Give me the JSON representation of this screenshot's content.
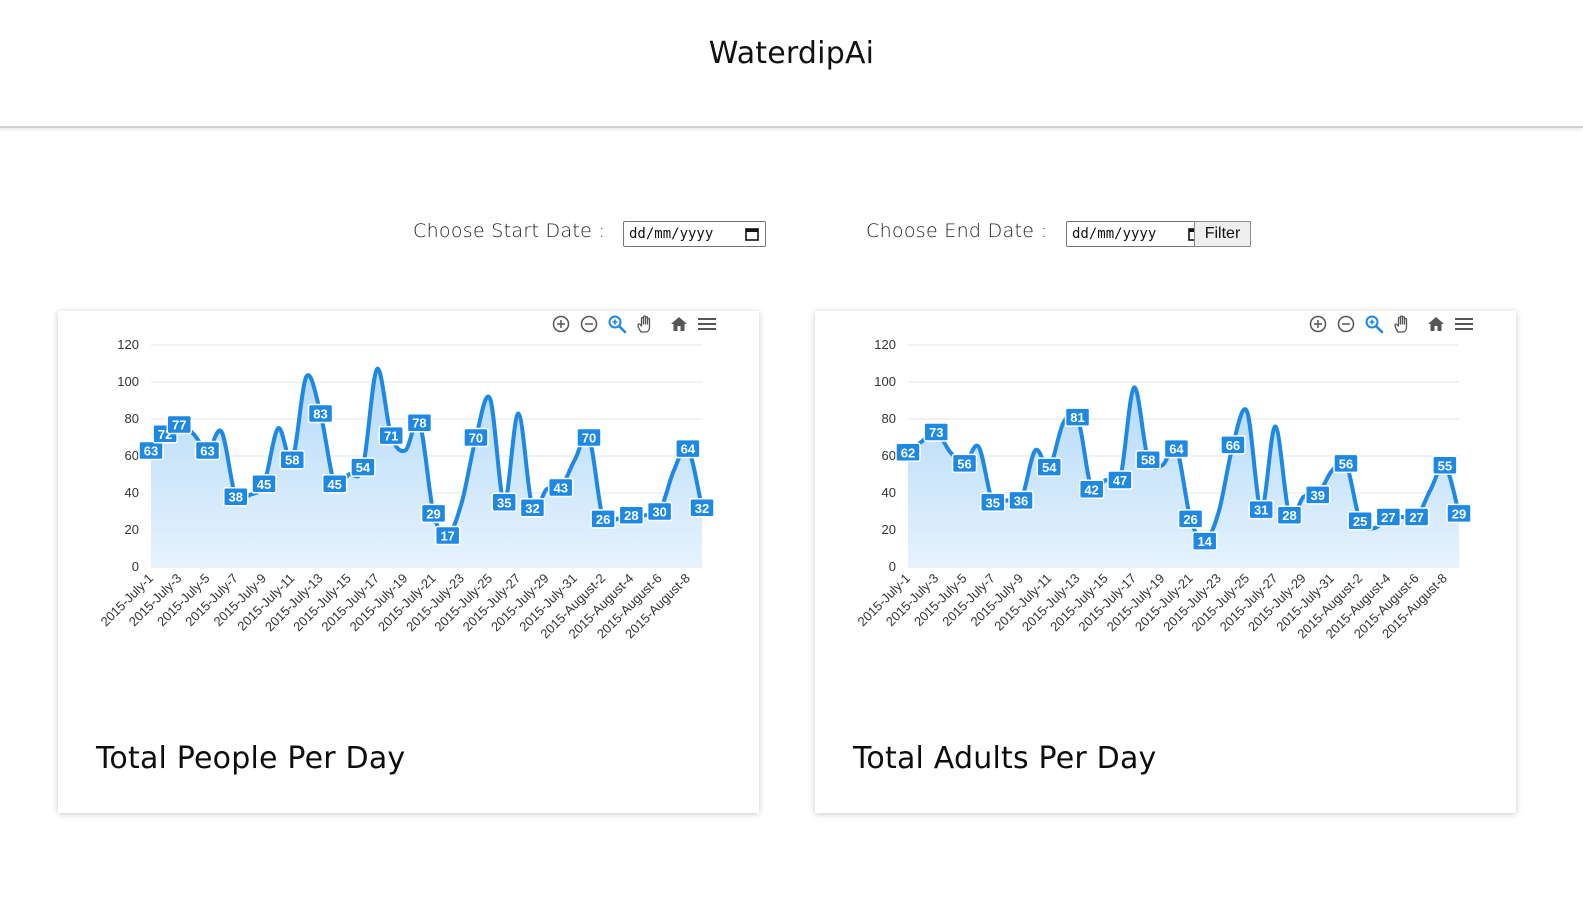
{
  "app": {
    "title": "WaterdipAi"
  },
  "filter": {
    "start_label": "Choose Start Date :",
    "end_label": "Choose End Date :",
    "date_placeholder": "dd/mm/yyyy",
    "filter_button": "Filter"
  },
  "toolbar_icons": [
    "zoom-in-icon",
    "zoom-out-icon",
    "selection-zoom-icon",
    "pan-hand-icon",
    "reset-home-icon",
    "menu-icon"
  ],
  "colors": {
    "accent": "#1e88e5",
    "fill_top": "#a9d4f7",
    "fill_bottom": "#e3f1fd",
    "grid": "#e6e6e6"
  },
  "charts": [
    {
      "title": "Total People Per Day",
      "chart_data": {
        "type": "area",
        "smooth": true,
        "ylim": [
          0,
          120
        ],
        "yticks": [
          0,
          20,
          40,
          60,
          80,
          100,
          120
        ],
        "x_tick_labels": [
          "2015-July-1",
          "2015-July-3",
          "2015-July-5",
          "2015-July-7",
          "2015-July-9",
          "2015-July-11",
          "2015-July-13",
          "2015-July-15",
          "2015-July-17",
          "2015-July-19",
          "2015-July-21",
          "2015-July-23",
          "2015-July-25",
          "2015-July-27",
          "2015-July-29",
          "2015-July-31",
          "2015-August-2",
          "2015-August-4",
          "2015-August-6",
          "2015-August-8"
        ],
        "values": [
          63,
          72,
          77,
          72,
          63,
          73,
          38,
          39,
          45,
          75,
          58,
          103,
          83,
          45,
          50,
          54,
          107,
          71,
          63,
          78,
          29,
          17,
          35,
          70,
          91,
          35,
          83,
          32,
          42,
          43,
          58,
          70,
          26,
          26,
          28,
          28,
          30,
          52,
          64,
          32
        ],
        "labels": [
          1,
          1,
          1,
          0,
          1,
          0,
          1,
          0,
          1,
          0,
          1,
          0,
          1,
          1,
          0,
          1,
          0,
          1,
          0,
          1,
          1,
          1,
          0,
          1,
          0,
          1,
          0,
          1,
          0,
          1,
          0,
          1,
          1,
          0,
          1,
          0,
          1,
          0,
          1,
          1
        ]
      }
    },
    {
      "title": "Total Adults Per Day",
      "chart_data": {
        "type": "area",
        "smooth": true,
        "ylim": [
          0,
          120
        ],
        "yticks": [
          0,
          20,
          40,
          60,
          80,
          100,
          120
        ],
        "x_tick_labels": [
          "2015-July-1",
          "2015-July-3",
          "2015-July-5",
          "2015-July-7",
          "2015-July-9",
          "2015-July-11",
          "2015-July-13",
          "2015-July-15",
          "2015-July-17",
          "2015-July-19",
          "2015-July-21",
          "2015-July-23",
          "2015-July-25",
          "2015-July-27",
          "2015-July-29",
          "2015-July-31",
          "2015-August-2",
          "2015-August-4",
          "2015-August-6",
          "2015-August-8"
        ],
        "values": [
          62,
          68,
          73,
          62,
          56,
          65,
          35,
          36,
          36,
          63,
          54,
          78,
          81,
          42,
          47,
          47,
          97,
          58,
          55,
          64,
          26,
          14,
          30,
          66,
          84,
          31,
          76,
          28,
          38,
          39,
          52,
          56,
          25,
          21,
          27,
          27,
          27,
          42,
          55,
          29
        ],
        "labels": [
          1,
          0,
          1,
          0,
          1,
          0,
          1,
          0,
          1,
          0,
          1,
          0,
          1,
          1,
          0,
          1,
          0,
          1,
          0,
          1,
          1,
          1,
          0,
          1,
          0,
          1,
          0,
          1,
          0,
          1,
          0,
          1,
          1,
          0,
          1,
          0,
          1,
          0,
          1,
          1
        ]
      }
    }
  ]
}
